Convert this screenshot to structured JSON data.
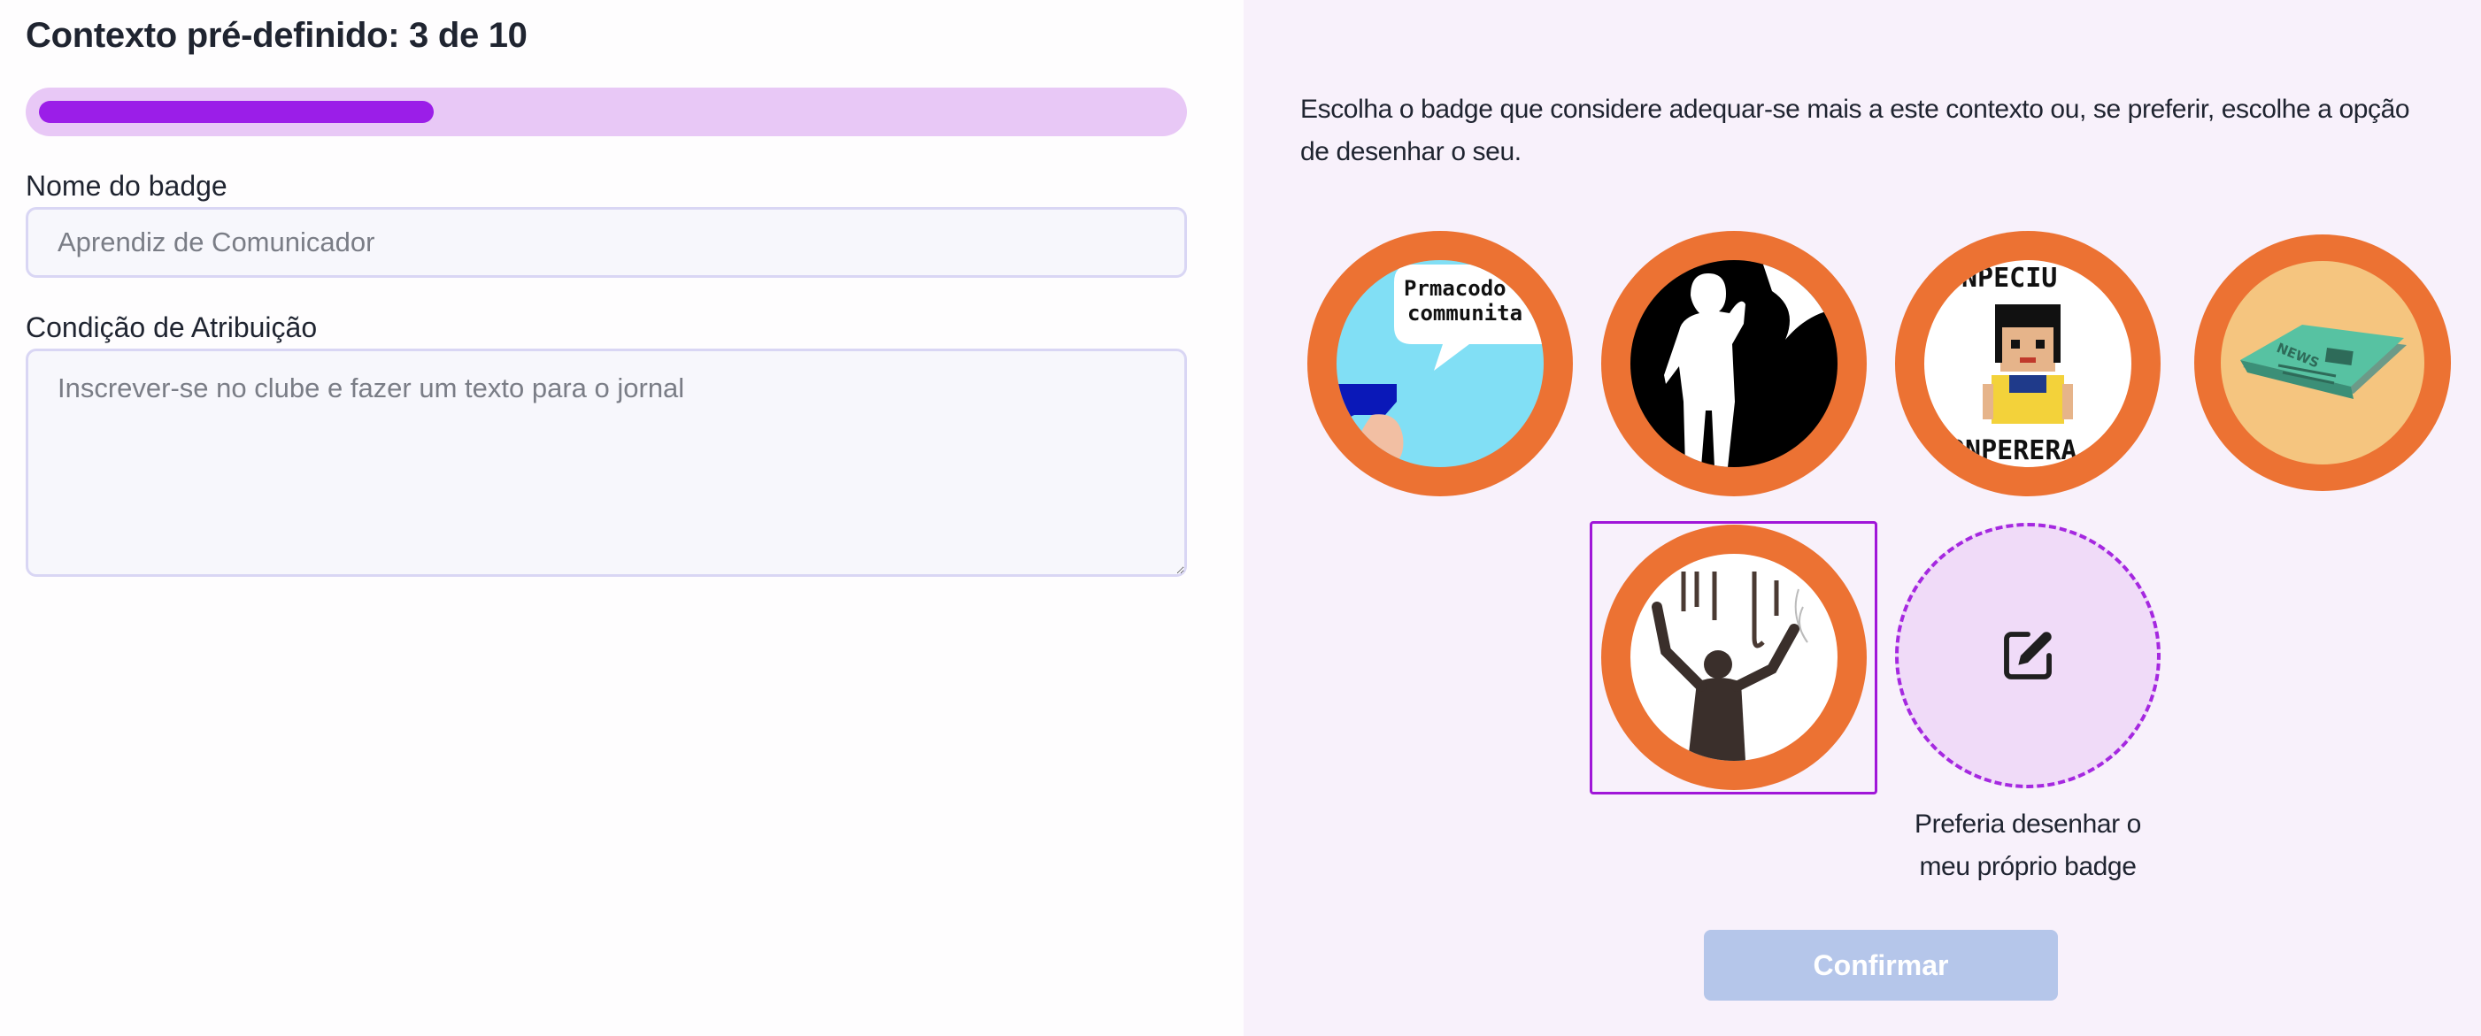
{
  "header": {
    "title": "Contexto pré-definido: 3 de 10"
  },
  "progress": {
    "current": 3,
    "total": 10,
    "fraction": 0.3
  },
  "form": {
    "name_label": "Nome do badge",
    "name_placeholder": "Aprendiz de Comunicador",
    "name_value": "",
    "condition_label": "Condição de Atribuição",
    "condition_placeholder": "Inscrever-se no clube e fazer um texto para o jornal",
    "condition_value": ""
  },
  "badges": {
    "instruction": "Escolha o badge que considere adequar-se mais a este contexto ou, se preferir, escolhe a opção de desenhar o seu.",
    "options": [
      {
        "icon": "speech-bubble-badge-icon",
        "text_line1": "Prmacodo",
        "text_line2": "communita",
        "selected": false
      },
      {
        "icon": "person-silhouette-badge-icon",
        "selected": false
      },
      {
        "icon": "pixel-character-badge-icon",
        "text_top": "NPECIU",
        "text_bottom": "ONPERERA",
        "selected": false
      },
      {
        "icon": "newspaper-badge-icon",
        "text_paper": "NEWS",
        "selected": false
      },
      {
        "icon": "person-raising-arms-badge-icon",
        "selected": true
      }
    ],
    "draw_own_label": "Preferia desenhar o meu próprio badge",
    "draw_icon": "edit-pencil-icon"
  },
  "actions": {
    "confirm_label": "Confirmar",
    "confirm_enabled": false
  },
  "colors": {
    "accent": "#9b1ee8",
    "progress_track": "#e8c8f6",
    "badge_ring": "#ec7233",
    "right_panel_bg": "#f8f1fb",
    "confirm_disabled_bg": "#b5c6ea"
  }
}
